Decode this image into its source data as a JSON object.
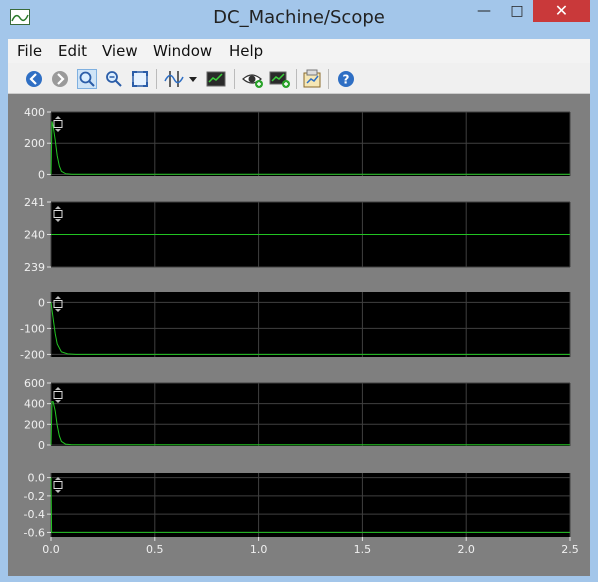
{
  "window": {
    "title": "DC_Machine/Scope",
    "icon": "scope-icon"
  },
  "menu": [
    "File",
    "Edit",
    "View",
    "Window",
    "Help"
  ],
  "toolbar_icons": [
    "back-icon",
    "forward-icon",
    "zoom-in-icon",
    "zoom-out-icon",
    "autoscale-icon",
    "cursor-measure-icon",
    "dropdown-icon",
    "scope-params-icon",
    "signal-visibility-icon",
    "add-signal-icon",
    "save-axes-icon",
    "help-icon"
  ],
  "chart_data": [
    {
      "type": "line",
      "ylim": [
        -10,
        400
      ],
      "yticks": [
        "400",
        "200",
        "0"
      ],
      "series": [
        {
          "values": [
            [
              0,
              0
            ],
            [
              0.005,
              340
            ],
            [
              0.01,
              310
            ],
            [
              0.02,
              220
            ],
            [
              0.03,
              120
            ],
            [
              0.04,
              55
            ],
            [
              0.05,
              20
            ],
            [
              0.07,
              5
            ],
            [
              0.1,
              1
            ],
            [
              2.5,
              1
            ]
          ]
        }
      ]
    },
    {
      "type": "line",
      "ylim": [
        239,
        241
      ],
      "yticks": [
        "241",
        "240",
        "239"
      ],
      "series": [
        {
          "values": [
            [
              0,
              240
            ],
            [
              2.5,
              240
            ]
          ]
        }
      ]
    },
    {
      "type": "line",
      "ylim": [
        -210,
        40
      ],
      "yticks": [
        "0",
        "-100",
        "-200"
      ],
      "series": [
        {
          "values": [
            [
              0,
              0
            ],
            [
              0.01,
              -60
            ],
            [
              0.02,
              -120
            ],
            [
              0.03,
              -160
            ],
            [
              0.05,
              -190
            ],
            [
              0.08,
              -198
            ],
            [
              0.12,
              -200
            ],
            [
              2.5,
              -200
            ]
          ]
        }
      ]
    },
    {
      "type": "line",
      "ylim": [
        -10,
        600
      ],
      "yticks": [
        "600",
        "400",
        "200",
        "0"
      ],
      "series": [
        {
          "values": [
            [
              0,
              0
            ],
            [
              0.005,
              420
            ],
            [
              0.01,
              420
            ],
            [
              0.02,
              330
            ],
            [
              0.03,
              190
            ],
            [
              0.04,
              90
            ],
            [
              0.05,
              35
            ],
            [
              0.07,
              8
            ],
            [
              0.1,
              2
            ],
            [
              2.5,
              2
            ]
          ]
        }
      ]
    },
    {
      "type": "line",
      "ylim": [
        -0.65,
        0.05
      ],
      "yticks": [
        "0.0",
        "-0.2",
        "-0.4",
        "-0.6"
      ],
      "series": [
        {
          "values": [
            [
              0,
              0
            ],
            [
              0.003,
              -0.6
            ],
            [
              2.5,
              -0.6
            ]
          ]
        }
      ]
    }
  ],
  "x_axis": {
    "xlim": [
      0,
      2.5
    ],
    "ticks": [
      "0.0",
      "0.5",
      "1.0",
      "1.5",
      "2.0",
      "2.5"
    ]
  },
  "colors": {
    "plot_bg": "#000000",
    "trace": "#22c422",
    "grid": "#404040",
    "frame_bg": "#7f7f7f",
    "titlebar": "#a3c6ea",
    "close_button": "#c9393a"
  }
}
